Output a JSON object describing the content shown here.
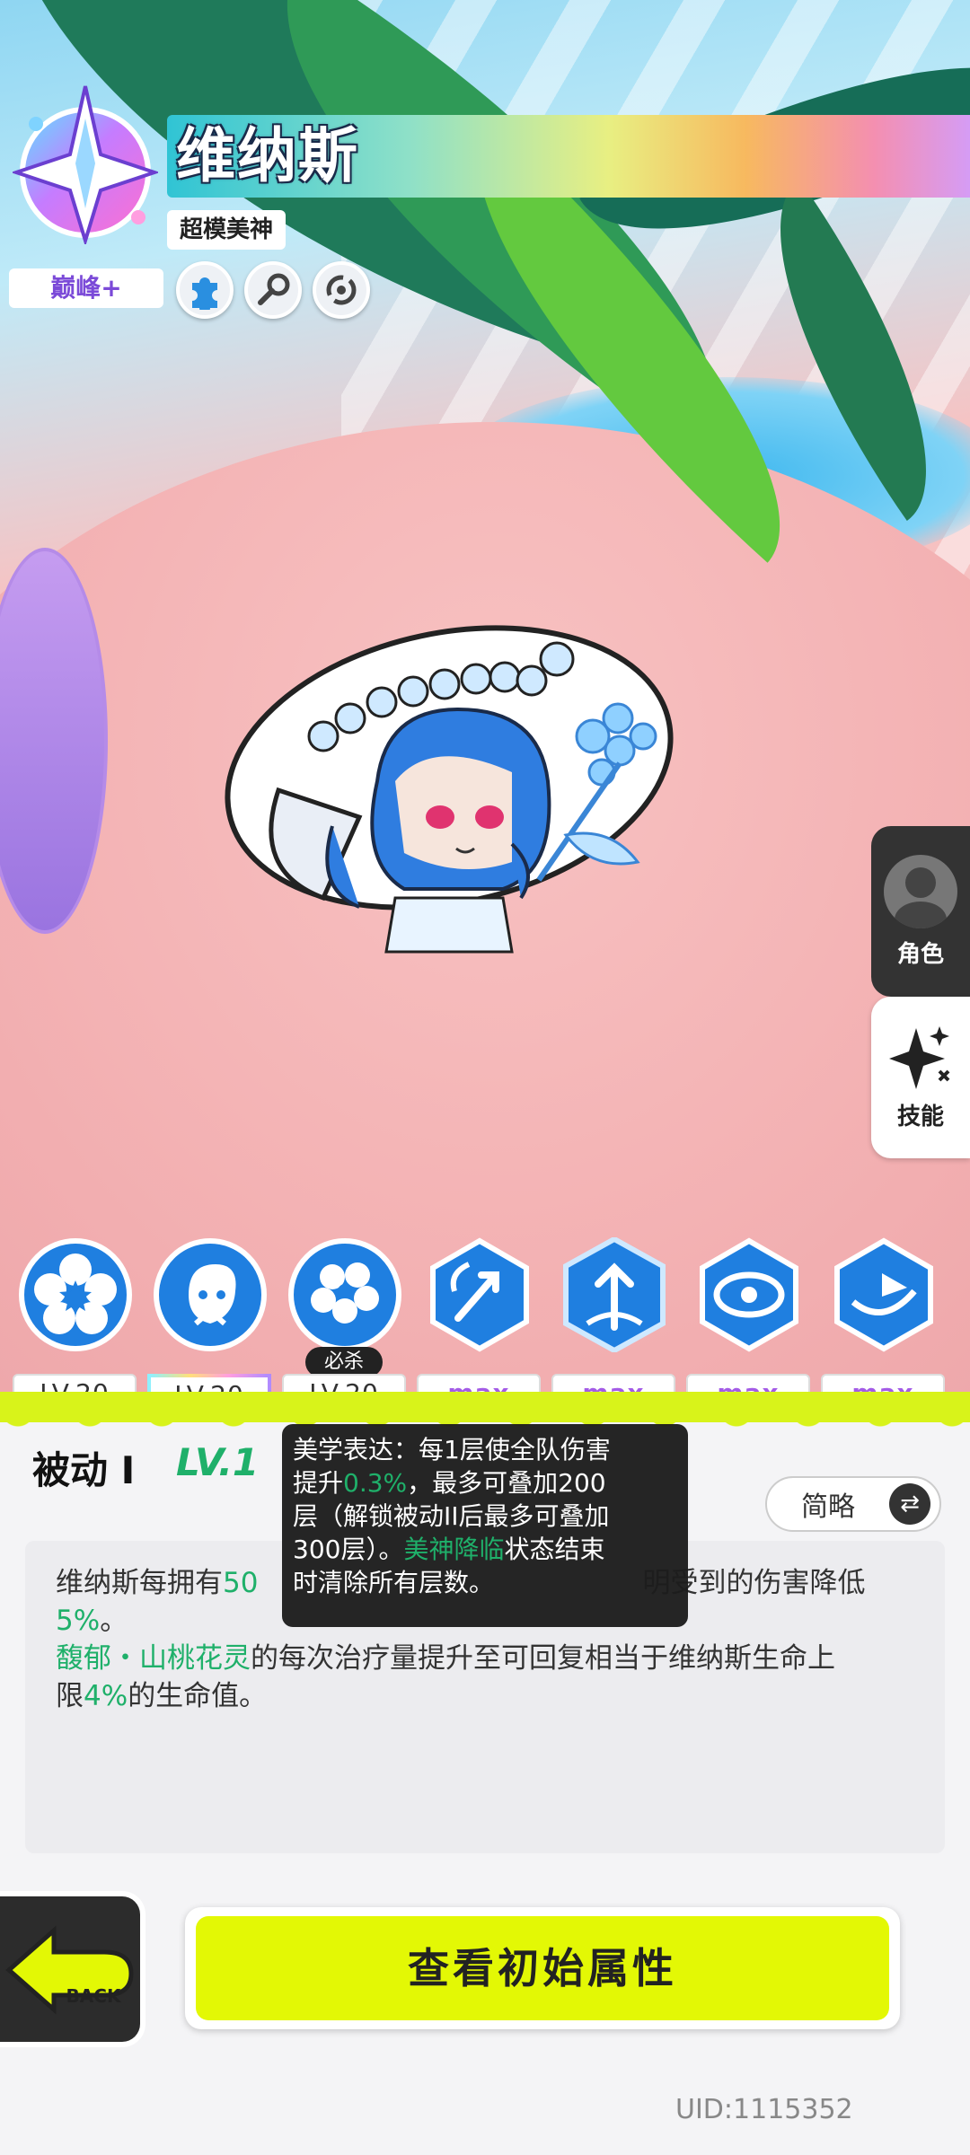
{
  "character": {
    "name": "维纳斯",
    "title": "超模美神",
    "rank": "巅峰+"
  },
  "side_tabs": {
    "role_label": "角色",
    "skill_label": "技能"
  },
  "skills": [
    {
      "level": "LV.20"
    },
    {
      "level": "LV.20"
    },
    {
      "level": "LV.20",
      "tag": "必杀"
    },
    {
      "level": "max"
    },
    {
      "level": "max"
    },
    {
      "level": "max"
    },
    {
      "level": "max"
    }
  ],
  "detail": {
    "skill_name": "被动 I",
    "skill_level": "LV.1",
    "toggle_label": "简略",
    "description": {
      "line1_a": "维纳斯每拥有",
      "line1_b": "50",
      "line1_c": "明受到的伤害降低",
      "line2_a": "5%",
      "line2_b": "。",
      "line3_a": "馥郁・山桃花灵",
      "line3_b": "的每次治疗量提升至可回复相当于维纳斯生命上",
      "line4_a": "限",
      "line4_b": "4%",
      "line4_c": "的生命值。"
    },
    "tooltip": {
      "line1": "美学表达：每1层使全队伤害",
      "line2_a": "提升",
      "line2_b": "0.3%",
      "line2_c": "，最多可叠加200",
      "line3": "层（解锁被动II后最多可叠加",
      "line4_a": "300层）。",
      "line4_b": "美神降临",
      "line4_c": "状态结束",
      "line5": "时清除所有层数。"
    }
  },
  "buttons": {
    "back_label": "BACK",
    "view_attributes_label": "查看初始属性"
  },
  "uid": "UID:1115352",
  "colors": {
    "accent_green": "#1fb06a",
    "button_lime": "#e3f805",
    "max_purple": "#a35be6"
  }
}
